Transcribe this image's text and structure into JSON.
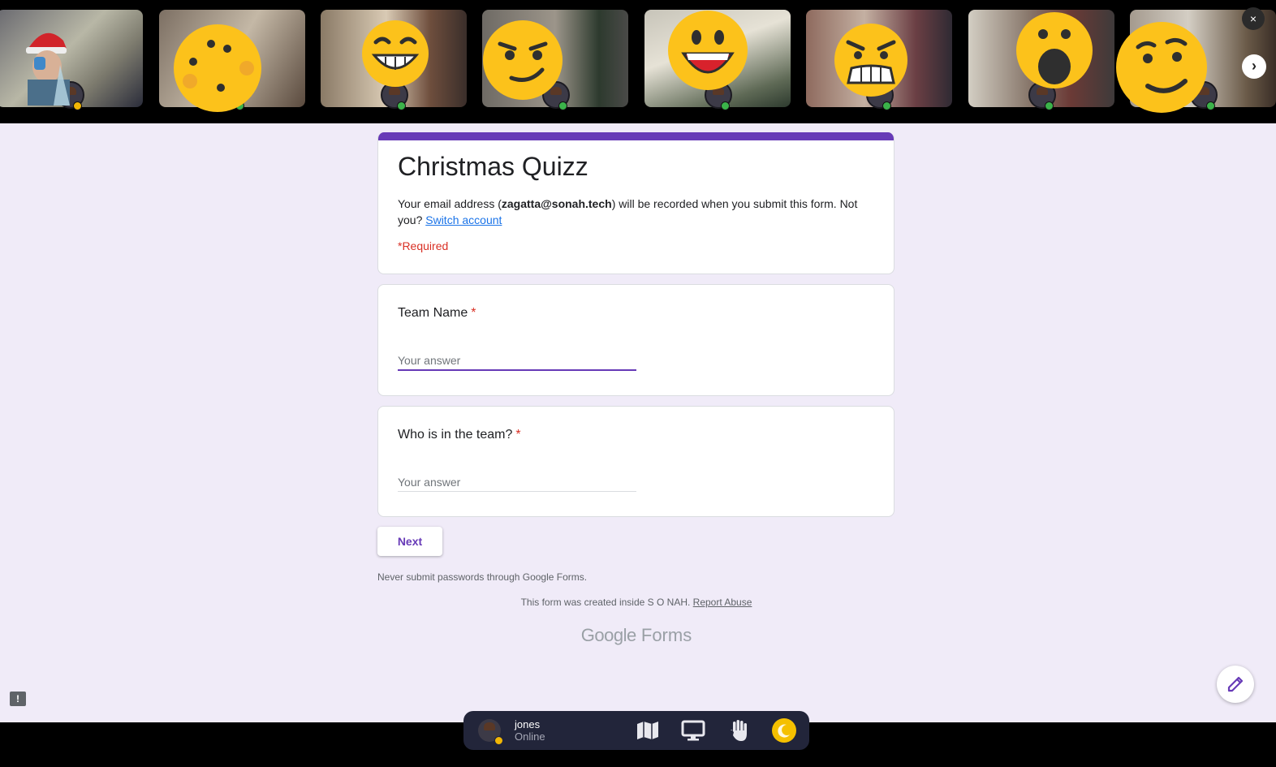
{
  "video_strip": {
    "tiles": [
      {
        "name": "participant-tile-1",
        "emoji": "none",
        "status": "away"
      },
      {
        "name": "participant-tile-2",
        "emoji": "cookie",
        "status": "online"
      },
      {
        "name": "participant-tile-3",
        "emoji": "grin",
        "status": "online"
      },
      {
        "name": "participant-tile-4",
        "emoji": "smirk",
        "status": "online"
      },
      {
        "name": "participant-tile-5",
        "emoji": "laugh",
        "status": "online"
      },
      {
        "name": "participant-tile-6",
        "emoji": "angry",
        "status": "online"
      },
      {
        "name": "participant-tile-7",
        "emoji": "surprised",
        "status": "online"
      },
      {
        "name": "participant-tile-8",
        "emoji": "thinking",
        "status": "online"
      }
    ],
    "close_label": "×",
    "next_label": "›"
  },
  "form": {
    "title": "Christmas Quizz",
    "email_notice_prefix": "Your email address (",
    "email": "zagatta@sonah.tech",
    "email_notice_suffix": ") will be recorded when you submit this form. Not you?",
    "switch_account": "Switch account",
    "required_note": "*Required",
    "questions": [
      {
        "title": "Team Name",
        "required_mark": "*",
        "placeholder": "Your answer",
        "value": ""
      },
      {
        "title": "Who is in the team?",
        "required_mark": "*",
        "placeholder": "Your answer",
        "value": ""
      }
    ],
    "next_label": "Next",
    "password_warning": "Never submit passwords through Google Forms.",
    "created_inside": "This form was created inside S O NAH.",
    "report_abuse": "Report Abuse",
    "logo_google": "Google",
    "logo_forms": "Forms"
  },
  "action_bar": {
    "user_name": "jones",
    "user_status": "Online"
  },
  "colors": {
    "accent": "#673ab7",
    "required": "#d93025",
    "page_bg": "#f0ebf8",
    "emoji_yellow": "#fcc21b"
  },
  "icons": [
    "close-icon",
    "chevron-right-icon",
    "edit-icon",
    "report-icon",
    "map-icon",
    "screen-share-icon",
    "raise-hand-icon",
    "moon-icon"
  ]
}
